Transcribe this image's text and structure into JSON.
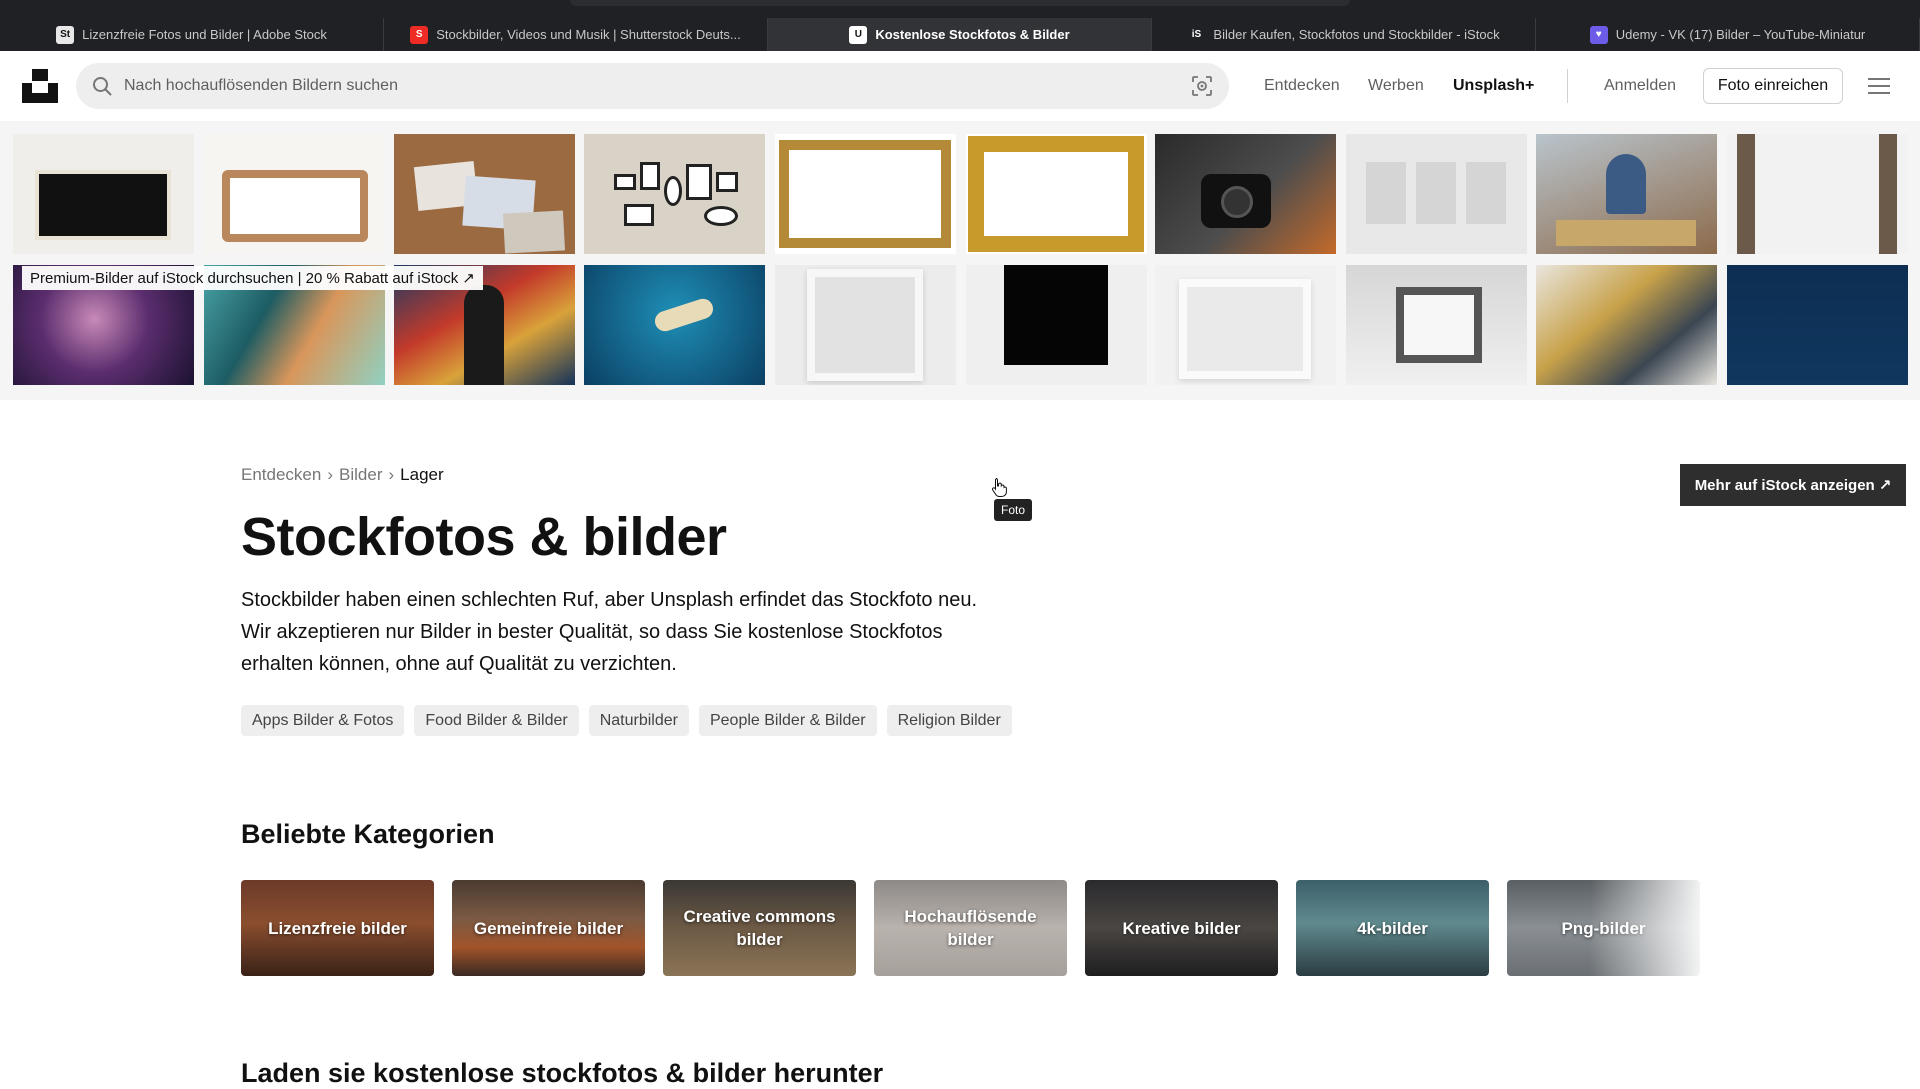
{
  "browser": {
    "tabs": [
      {
        "label": "Lizenzfreie Fotos und Bilder | Adobe Stock",
        "favicon": "St",
        "color": "#e8e8e8",
        "active": false
      },
      {
        "label": "Stockbilder, Videos und Musik | Shutterstock Deuts...",
        "favicon": "S",
        "color": "#ee2b24",
        "active": false
      },
      {
        "label": "Kostenlose Stockfotos & Bilder",
        "favicon": "U",
        "color": "#ffffff",
        "active": true
      },
      {
        "label": "Bilder Kaufen, Stockfotos und Stockbilder - iStock",
        "favicon": "iS",
        "color": "#202124",
        "active": false
      },
      {
        "label": "Udemy - VK (17) Bilder – YouTube-Miniatur",
        "favicon": "♥",
        "color": "#6c5ce7",
        "active": false
      }
    ]
  },
  "header": {
    "search_placeholder": "Nach hochauflösenden Bildern suchen",
    "nav_entdecken": "Entdecken",
    "nav_werben": "Werben",
    "nav_plus": "Unsplash+",
    "nav_login": "Anmelden",
    "submit_label": "Foto einreichen"
  },
  "banner": {
    "promo_text": "Premium-Bilder auf iStock durchsuchen | 20 % Rabatt auf iStock",
    "more_label": "Mehr auf iStock anzeigen",
    "tooltip": "Foto"
  },
  "main": {
    "breadcrumb": [
      "Entdecken",
      "Bilder",
      "Lager"
    ],
    "breadcrumb_sep": "›",
    "title": "Stockfotos & bilder",
    "intro": "Stockbilder haben einen schlechten Ruf, aber Unsplash erfindet das Stockfoto neu. Wir akzeptieren nur Bilder in bester Qualität, so dass Sie kostenlose Stockfotos erhalten können, ohne auf Qualität zu verzichten.",
    "tags": [
      "Apps Bilder & Fotos",
      "Food Bilder & Bilder",
      "Naturbilder",
      "People Bilder & Bilder",
      "Religion Bilder"
    ],
    "categories_title": "Beliebte Kategorien",
    "categories": [
      {
        "label": "Lizenzfreie bilder"
      },
      {
        "label": "Gemeinfreie bilder"
      },
      {
        "label": "Creative commons bilder"
      },
      {
        "label": "Hochauflösende bilder"
      },
      {
        "label": "Kreative bilder"
      },
      {
        "label": "4k-bilder"
      },
      {
        "label": "Png-bilder"
      }
    ],
    "download_title": "Laden sie kostenlose stockfotos & bilder herunter"
  }
}
